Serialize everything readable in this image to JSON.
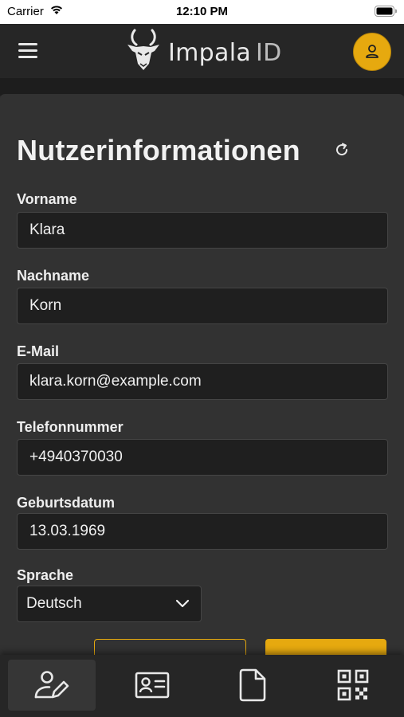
{
  "status_bar": {
    "carrier": "Carrier",
    "time": "12:10 PM"
  },
  "header": {
    "logo_name": "Impala",
    "logo_suffix": "ID",
    "menu_icon": "hamburger-menu-icon",
    "avatar_icon": "user-icon"
  },
  "form": {
    "title": "Nutzerinformationen",
    "refresh_icon": "refresh-icon",
    "fields": [
      {
        "label": "Vorname",
        "value": "Klara"
      },
      {
        "label": "Nachname",
        "value": "Korn"
      },
      {
        "label": "E-Mail",
        "value": "klara.korn@example.com"
      },
      {
        "label": "Telefonnummer",
        "value": "+4940370030"
      },
      {
        "label": "Geburtsdatum",
        "value": "13.03.1969"
      }
    ],
    "language": {
      "label": "Sprache",
      "selected": "Deutsch"
    }
  },
  "bottom_nav": {
    "items": [
      {
        "icon": "user-edit-icon",
        "active": true
      },
      {
        "icon": "id-card-icon",
        "active": false
      },
      {
        "icon": "document-icon",
        "active": false
      },
      {
        "icon": "qr-code-icon",
        "active": false
      }
    ]
  },
  "colors": {
    "accent": "#e6a90f",
    "background": "#2a2a2a",
    "card": "#323232",
    "input_bg": "#1f1f1f"
  }
}
